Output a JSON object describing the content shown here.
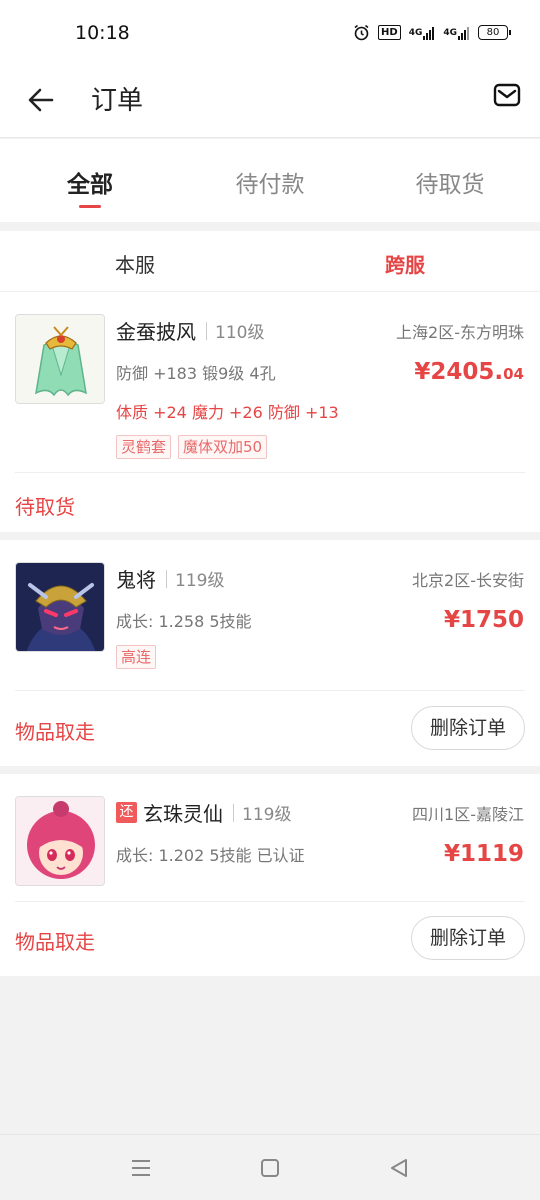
{
  "status_bar": {
    "time": "10:18",
    "hd": "HD",
    "net1": "4G",
    "net2": "4G",
    "battery": "80"
  },
  "app_bar": {
    "title": "订单"
  },
  "tabs": [
    {
      "label": "全部"
    },
    {
      "label": "待付款"
    },
    {
      "label": "待取货"
    }
  ],
  "segments": [
    {
      "label": "本服"
    },
    {
      "label": "跨服"
    }
  ],
  "orders": [
    {
      "name": "金蚕披风",
      "level": "110级",
      "server": "上海2区-东方明珠",
      "attrs": "防御 +183  锻9级  4孔",
      "special": "体质 +24 魔力 +26 防御 +13",
      "tags": [
        "灵鹤套",
        "魔体双加50"
      ],
      "price_int": "¥2405.",
      "price_dec": "04",
      "status": "待取货"
    },
    {
      "name": "鬼将",
      "level": "119级",
      "server": "北京2区-长安街",
      "attrs": "成长: 1.258  5技能",
      "tags": [
        "高连"
      ],
      "price_int": "¥1750",
      "status": "物品取走",
      "action": "删除订单"
    },
    {
      "badge": "还",
      "name": "玄珠灵仙",
      "level": "119级",
      "server": "四川1区-嘉陵江",
      "attrs": "成长: 1.202  5技能  已认证",
      "price_int": "¥1119",
      "status": "物品取走",
      "action": "删除订单"
    }
  ],
  "colors": {
    "accent": "#e64545",
    "background": "#f2f2f2"
  },
  "icons": {
    "back": "arrow-left-icon",
    "mail": "mail-icon",
    "nav": [
      "menu-icon",
      "home-square-icon",
      "back-triangle-icon"
    ]
  }
}
